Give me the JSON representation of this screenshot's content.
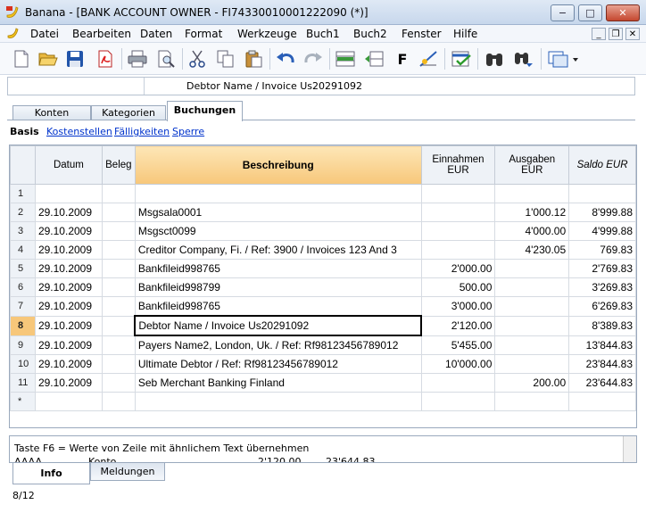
{
  "window": {
    "title": "Banana - [BANK ACCOUNT OWNER - FI7433001000122209​0 (*)]",
    "min_label": "−",
    "max_label": "□",
    "close_label": "✕"
  },
  "menu": [
    "Datei",
    "Bearbeiten",
    "Daten",
    "Format",
    "Werkzeuge",
    "Buch1",
    "Buch2",
    "Fenster",
    "Hilfe"
  ],
  "mdi": {
    "min": "_",
    "restore": "❐",
    "close": "✕"
  },
  "toolbar": {
    "font_label": "F",
    "icons": [
      "new-file-icon",
      "open-folder-icon",
      "save-icon",
      "pdf-icon",
      "print-icon",
      "print-preview-icon",
      "cut-icon",
      "copy-icon",
      "paste-icon",
      "undo-icon",
      "redo-icon",
      "insert-row-icon",
      "add-row-icon",
      "font-icon",
      "format-icon",
      "check-icon",
      "find-icon",
      "find-next-icon",
      "window-icon"
    ]
  },
  "cellbar": {
    "content": "Debtor Name /  Invoice Us20291092"
  },
  "tabs": [
    "Konten",
    "Kategorien",
    "Buchungen"
  ],
  "active_tab": "Buchungen",
  "subnav": {
    "active": "Basis",
    "links": [
      "Kostenstellen",
      "Fälligkeiten",
      "Sperre"
    ]
  },
  "table": {
    "headers": {
      "date": "Datum",
      "doc": "Beleg",
      "desc": "Beschreibung",
      "income": "Einnahmen EUR",
      "expense": "Ausgaben EUR",
      "balance": "Saldo EUR"
    },
    "rows": [
      {
        "n": "1",
        "date": "",
        "doc": "",
        "desc": "",
        "income": "",
        "expense": "",
        "balance": ""
      },
      {
        "n": "2",
        "date": "29.10.2009",
        "doc": "",
        "desc": "Msgsala0001",
        "income": "",
        "expense": "1'000.12",
        "balance": "8'999.88"
      },
      {
        "n": "3",
        "date": "29.10.2009",
        "doc": "",
        "desc": "Msgsct0099",
        "income": "",
        "expense": "4'000.00",
        "balance": "4'999.88"
      },
      {
        "n": "4",
        "date": "29.10.2009",
        "doc": "",
        "desc": "Creditor Company, Fi.  / Ref: 3900 /  Invoices 123 And 3",
        "income": "",
        "expense": "4'230.05",
        "balance": "769.83"
      },
      {
        "n": "5",
        "date": "29.10.2009",
        "doc": "",
        "desc": "Bankfileid998765",
        "income": "2'000.00",
        "expense": "",
        "balance": "2'769.83"
      },
      {
        "n": "6",
        "date": "29.10.2009",
        "doc": "",
        "desc": "Bankfileid998799",
        "income": "500.00",
        "expense": "",
        "balance": "3'269.83"
      },
      {
        "n": "7",
        "date": "29.10.2009",
        "doc": "",
        "desc": "Bankfileid998765",
        "income": "3'000.00",
        "expense": "",
        "balance": "6'269.83"
      },
      {
        "n": "8",
        "date": "29.10.2009",
        "doc": "",
        "desc": "Debtor Name /  Invoice Us20291092",
        "income": "2'120.00",
        "expense": "",
        "balance": "8'389.83"
      },
      {
        "n": "9",
        "date": "29.10.2009",
        "doc": "",
        "desc": "Payers Name2, London, Uk.  / Ref: Rf98123456789012",
        "income": "5'455.00",
        "expense": "",
        "balance": "13'844.83"
      },
      {
        "n": "10",
        "date": "29.10.2009",
        "doc": "",
        "desc": "Ultimate Debtor / Ref: Rf98123456789012",
        "income": "10'000.00",
        "expense": "",
        "balance": "23'844.83"
      },
      {
        "n": "11",
        "date": "29.10.2009",
        "doc": "",
        "desc": "Seb Merchant Banking Finland",
        "income": "",
        "expense": "200.00",
        "balance": "23'644.83"
      },
      {
        "n": "*",
        "date": "",
        "doc": "",
        "desc": "",
        "income": "",
        "expense": "",
        "balance": ""
      }
    ]
  },
  "info": {
    "line1": "Taste F6 = Werte von Zeile mit ähnlichem Text übernehmen",
    "line2_a": "AAAA",
    "line2_b": "Konto",
    "line2_c": "2'120.00",
    "line2_d": "23'644.83"
  },
  "bottom_tabs": [
    "Info",
    "Meldungen"
  ],
  "status": "8/12"
}
